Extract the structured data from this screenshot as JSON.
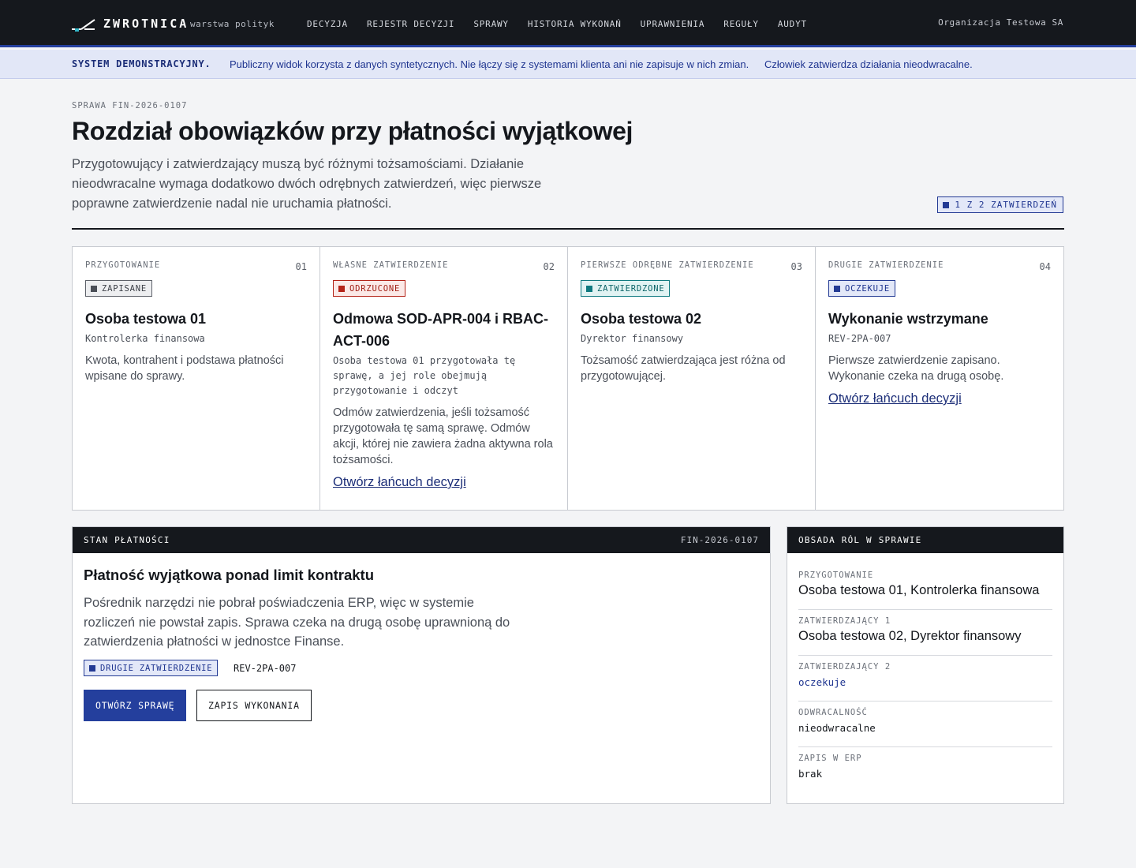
{
  "app": {
    "brand": "ZWROTNICA",
    "brand_subtitle": "warstwa polityk",
    "organization": "Organizacja Testowa SA",
    "accent_color": "#243f9d"
  },
  "nav": [
    "DECYZJA",
    "REJESTR DECYZJI",
    "SPRAWY",
    "HISTORIA WYKONAŃ",
    "UPRAWNIENIA",
    "REGUŁY",
    "AUDYT"
  ],
  "banner": {
    "label": "SYSTEM DEMONSTRACYJNY.",
    "text": "Publiczny widok korzysta z danych syntetycznych. Nie łączy się z systemami klienta ani nie zapisuje w nich zmian.",
    "text2": "Człowiek zatwierdza działania nieodwracalne."
  },
  "header": {
    "case_id": "SPRAWA FIN-2026-0107",
    "title": "Rozdział obowiązków przy płatności wyjątkowej",
    "lead": "Przygotowujący i zatwierdzający muszą być różnymi tożsamościami. Działanie nieodwracalne wymaga dodatkowo dwóch odrębnych zatwierdzeń, więc pierwsze poprawne zatwierdzenie nadal nie uruchamia płatności.",
    "count_badge": "1 Z 2 ZATWIERDZEŃ"
  },
  "steps": [
    {
      "label": "PRZYGOTOWANIE",
      "num": "01",
      "status": "ZAPISANE",
      "status_color": "gray",
      "title": "Osoba testowa 01",
      "subtitle": "Kontrolerka finansowa",
      "text": "Kwota, kontrahent i podstawa płatności wpisane do sprawy.",
      "link": ""
    },
    {
      "label": "WŁASNE ZATWIERDZENIE",
      "num": "02",
      "status": "ODRZUCONE",
      "status_color": "red",
      "title": "Odmowa SOD-APR-004 i RBAC-ACT-006",
      "subtitle": "Osoba testowa 01 przygotowała tę sprawę, a jej role obejmują przygotowanie i odczyt",
      "text": "Odmów zatwierdzenia, jeśli tożsamość przygotowała tę samą sprawę. Odmów akcji, której nie zawiera żadna aktywna rola tożsamości.",
      "link": "Otwórz łańcuch decyzji"
    },
    {
      "label": "PIERWSZE ODRĘBNE ZATWIERDZENIE",
      "num": "03",
      "status": "ZATWIERDZONE",
      "status_color": "teal",
      "title": "Osoba testowa 02",
      "subtitle": "Dyrektor finansowy",
      "text": "Tożsamość zatwierdzająca jest różna od przygotowującej.",
      "link": ""
    },
    {
      "label": "DRUGIE ZATWIERDZENIE",
      "num": "04",
      "status": "OCZEKUJE",
      "status_color": "blue",
      "title": "Wykonanie wstrzymane",
      "subtitle": "REV-2PA-007",
      "text": "Pierwsze zatwierdzenie zapisano. Wykonanie czeka na drugą osobę.",
      "link": "Otwórz łańcuch decyzji"
    }
  ],
  "payment": {
    "head_label": "STAN PŁATNOŚCI",
    "head_ref": "FIN-2026-0107",
    "title": "Płatność wyjątkowa ponad limit kontraktu",
    "text": "Pośrednik narzędzi nie pobrał poświadczenia ERP, więc w systemie rozliczeń nie powstał zapis. Sprawa czeka na drugą osobę uprawnioną do zatwierdzenia płatności w jednostce Finanse.",
    "badge": "DRUGIE ZATWIERDZENIE",
    "ref": "REV-2PA-007",
    "primary_button": "OTWÓRZ SPRAWĘ",
    "secondary_button": "ZAPIS WYKONANIA"
  },
  "roles": {
    "head_label": "OBSADA RÓL W SPRAWIE",
    "items": [
      {
        "label": "PRZYGOTOWANIE",
        "value": "Osoba testowa 01, Kontrolerka finansowa"
      },
      {
        "label": "ZATWIERDZAJĄCY 1",
        "value": "Osoba testowa 02, Dyrektor finansowy"
      },
      {
        "label": "ZATWIERDZAJĄCY 2",
        "value": "oczekuje"
      },
      {
        "label": "ODWRACALNOŚĆ",
        "value": "nieodwracalne"
      },
      {
        "label": "ZAPIS W ERP",
        "value": "brak"
      }
    ]
  }
}
